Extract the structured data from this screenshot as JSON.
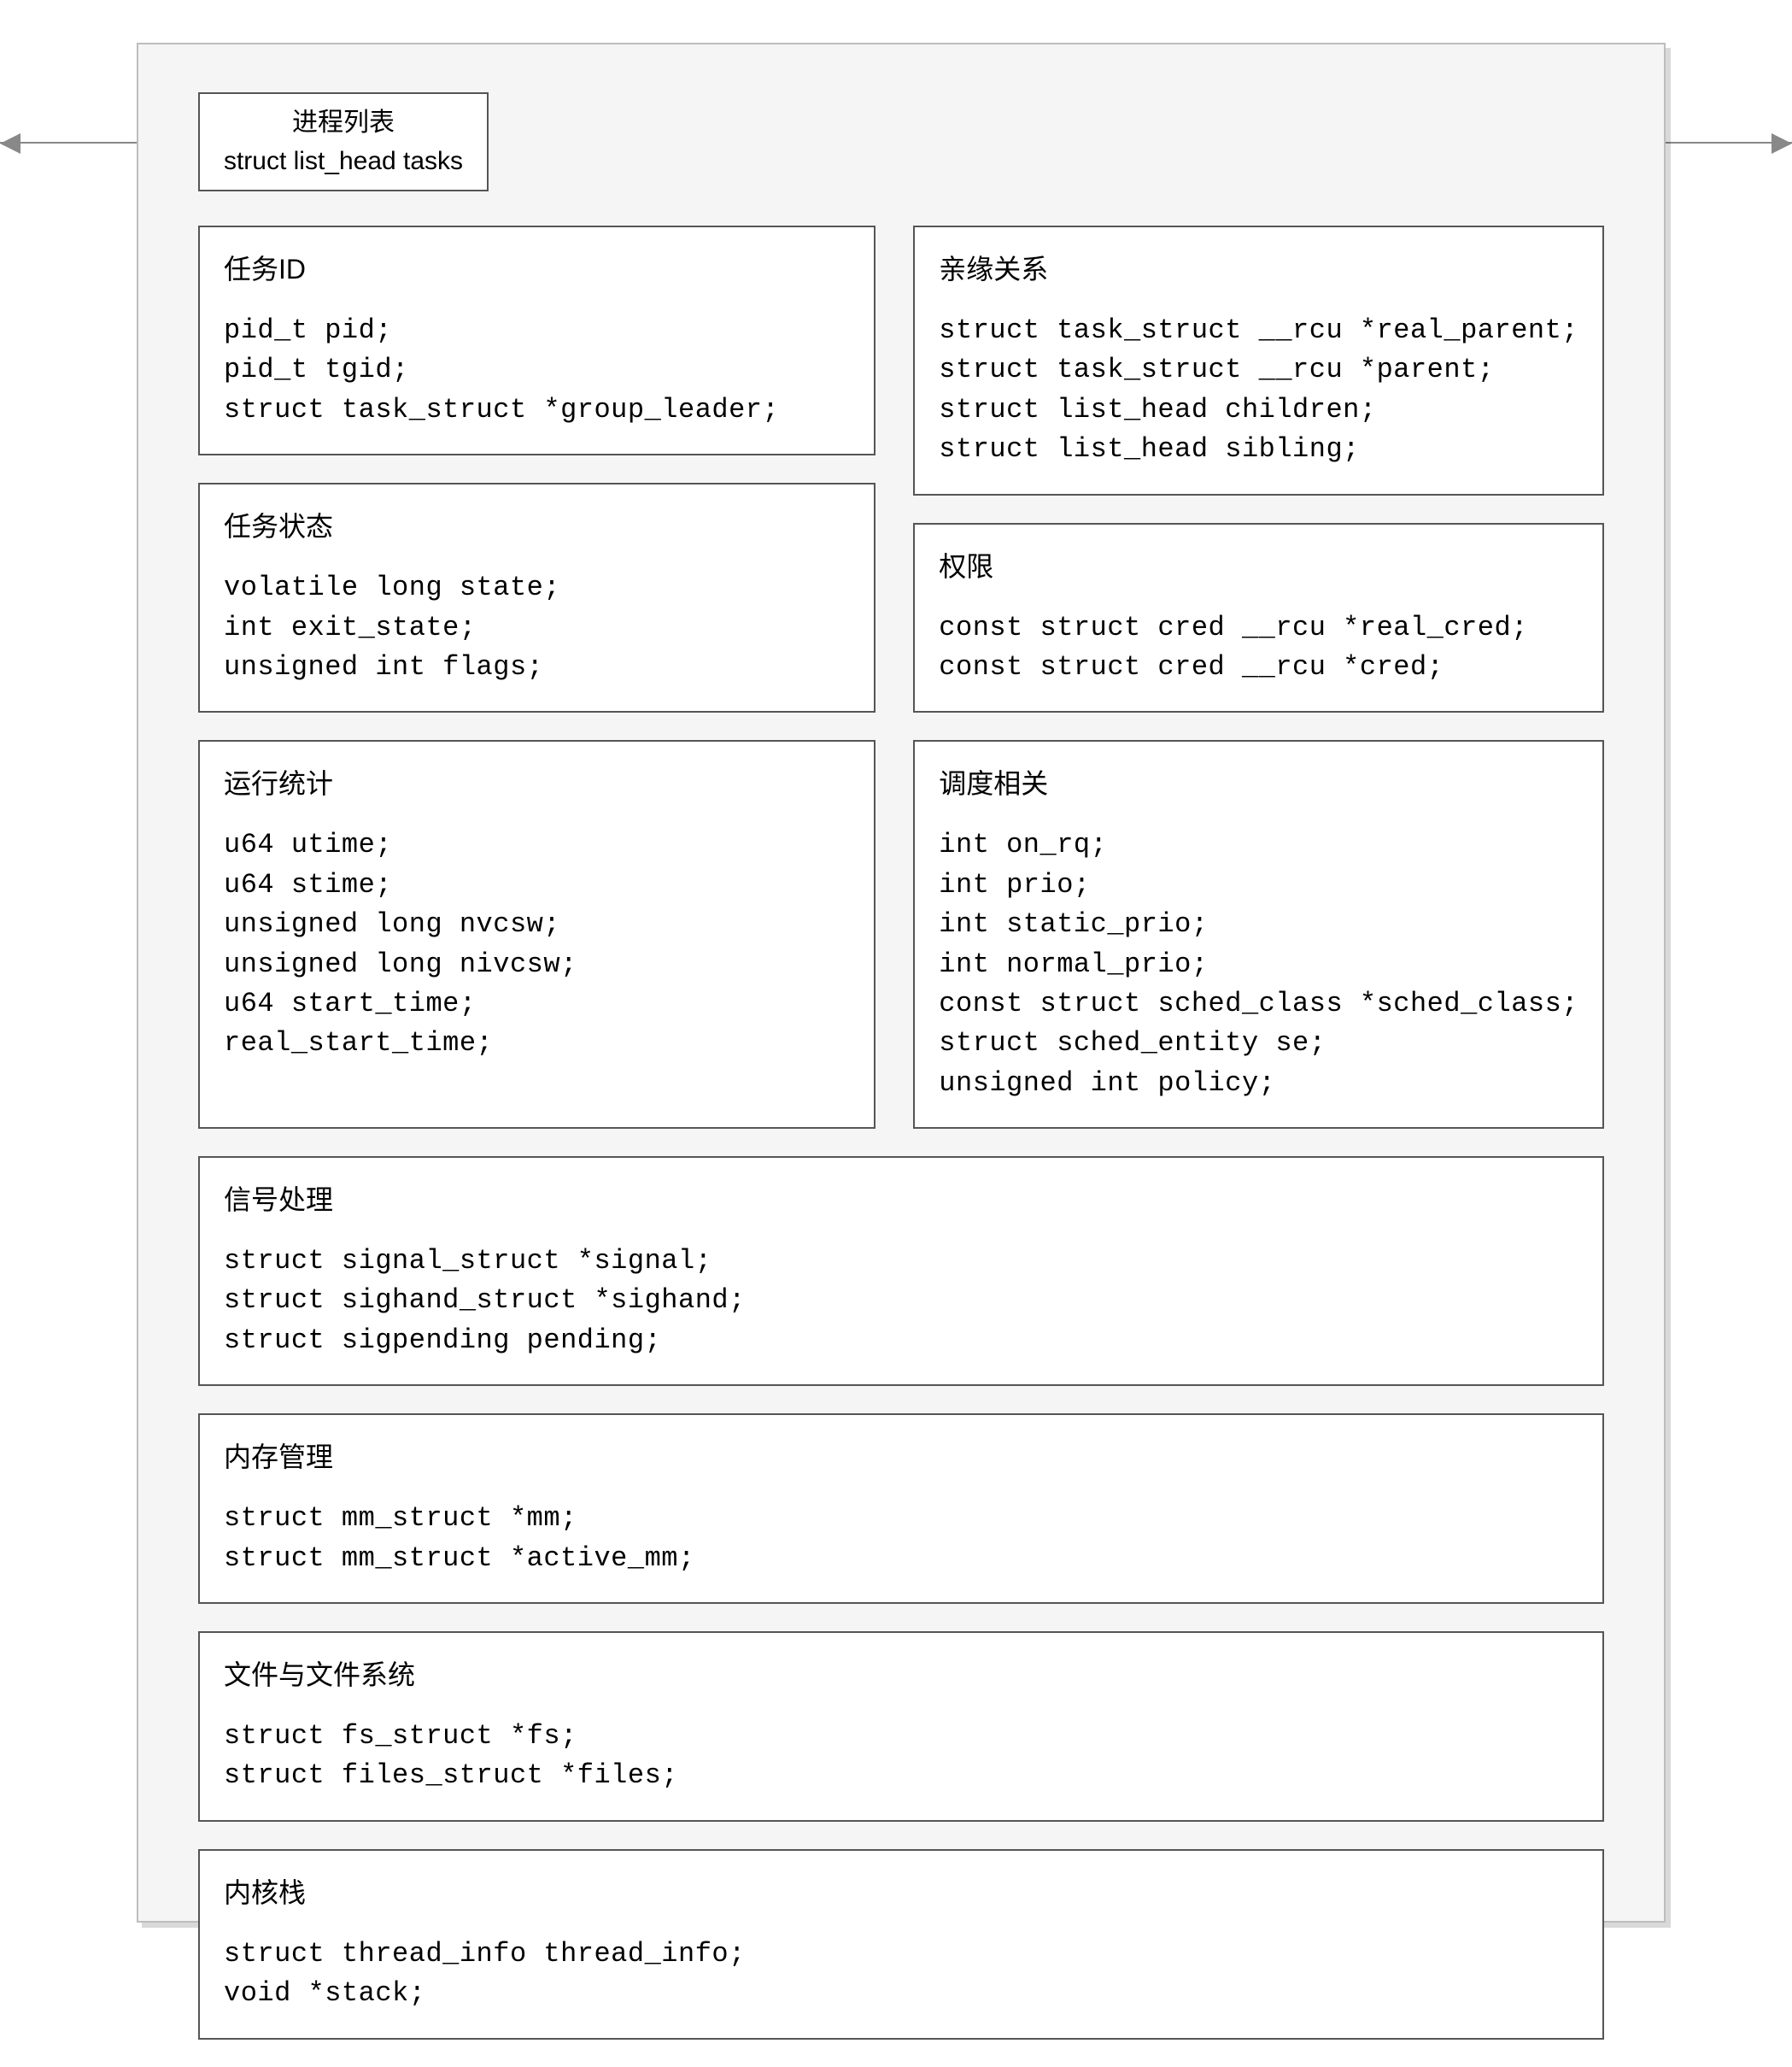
{
  "header": {
    "line1": "进程列表",
    "line2": "struct list_head tasks"
  },
  "boxes": {
    "task_id": {
      "title": "任务ID",
      "code": "pid_t pid;\npid_t tgid;\nstruct task_struct *group_leader;"
    },
    "kinship": {
      "title": "亲缘关系",
      "code": "struct task_struct __rcu *real_parent;\nstruct task_struct __rcu *parent;\nstruct list_head children;\nstruct list_head sibling;"
    },
    "task_state": {
      "title": "任务状态",
      "code": "volatile long state;\nint exit_state;\nunsigned int flags;"
    },
    "permission": {
      "title": "权限",
      "code": "const struct cred __rcu *real_cred;\nconst struct cred __rcu *cred;"
    },
    "run_stats": {
      "title": "运行统计",
      "code": "u64 utime;\nu64 stime;\nunsigned long nvcsw;\nunsigned long nivcsw;\nu64 start_time;\nreal_start_time;"
    },
    "sched": {
      "title": "调度相关",
      "code": "int on_rq;\nint prio;\nint static_prio;\nint normal_prio;\nconst struct sched_class *sched_class;\nstruct sched_entity se;\nunsigned int policy;"
    },
    "signal": {
      "title": "信号处理",
      "code": "struct signal_struct *signal;\nstruct sighand_struct *sighand;\nstruct sigpending pending;"
    },
    "memory": {
      "title": "内存管理",
      "code": "struct mm_struct *mm;\nstruct mm_struct *active_mm;"
    },
    "files": {
      "title": "文件与文件系统",
      "code": "struct fs_struct *fs;\nstruct files_struct *files;"
    },
    "kstack": {
      "title": "内核栈",
      "code": "struct thread_info thread_info;\nvoid *stack;"
    }
  },
  "watermark": ""
}
